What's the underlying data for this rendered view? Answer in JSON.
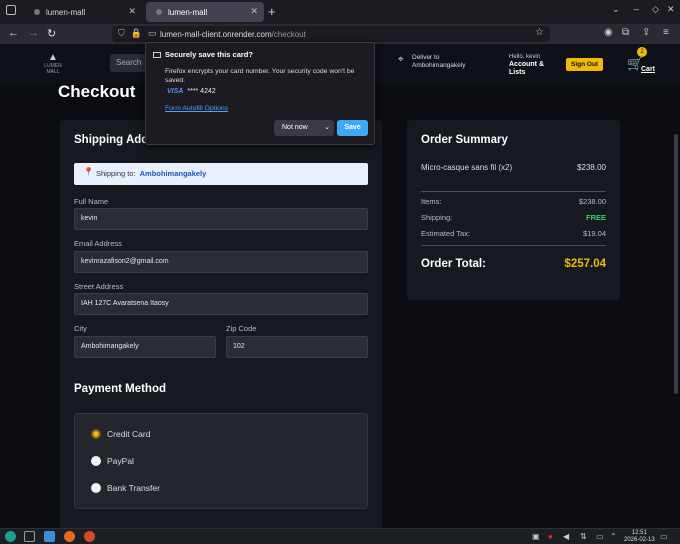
{
  "browser": {
    "tabs": [
      {
        "label": "lumen-mall"
      },
      {
        "label": "lumen-mall"
      }
    ],
    "new_tab": "+",
    "url": {
      "host": "lumen-mall-client.onrender.com",
      "path": "/checkout"
    }
  },
  "site": {
    "logo_text": "LUMEN MALL",
    "search_placeholder": "Search",
    "deliver": {
      "line1": "Deliver to",
      "line2": "Ambohimangakely"
    },
    "account": {
      "greeting": "Hello, kevin",
      "label": "Account & Lists"
    },
    "signout_label": "Sign Out",
    "cart": {
      "count": "2",
      "label": "Cart"
    }
  },
  "page_title": "Checkout",
  "shipping": {
    "title": "Shipping Address",
    "banner_label": "Shipping to:",
    "banner_value": "Ambohimangakely",
    "full_name_label": "Full Name",
    "full_name": "kevin",
    "email_label": "Email Address",
    "email": "kevinrazafison2@gmail.com",
    "street_label": "Street Address",
    "street": "IAH 127C Avaratsena Itaosy",
    "city_label": "City",
    "city": "Ambohimangakely",
    "zip_label": "Zip Code",
    "zip": "102"
  },
  "payment": {
    "title": "Payment Method",
    "options": [
      {
        "label": "Credit Card",
        "selected": true
      },
      {
        "label": "PayPal",
        "selected": false
      },
      {
        "label": "Bank Transfer",
        "selected": false
      }
    ]
  },
  "summary": {
    "title": "Order Summary",
    "item_name": "Micro-casque sans fil (x2)",
    "item_price": "$238.00",
    "items_label": "Items:",
    "items_value": "$238.00",
    "shipping_label": "Shipping:",
    "shipping_value": "FREE",
    "tax_label": "Estimated Tax:",
    "tax_value": "$19.04",
    "total_label": "Order Total:",
    "total_value": "$257.04"
  },
  "popup": {
    "title": "Securely save this card?",
    "description": "Firefox encrypts your card number. Your security code won't be saved.",
    "card_brand": "VISA",
    "card_number": "**** 4242",
    "link": "Form Autofill Options",
    "not_now": "Not now",
    "save": "Save"
  },
  "taskbar": {
    "time": "12:51",
    "date": "2026-02-13"
  },
  "colors": {
    "accent": "#f0b90b",
    "link": "#4aa3ff",
    "save_button": "#3fa9f5",
    "free": "#3ecf6e"
  }
}
